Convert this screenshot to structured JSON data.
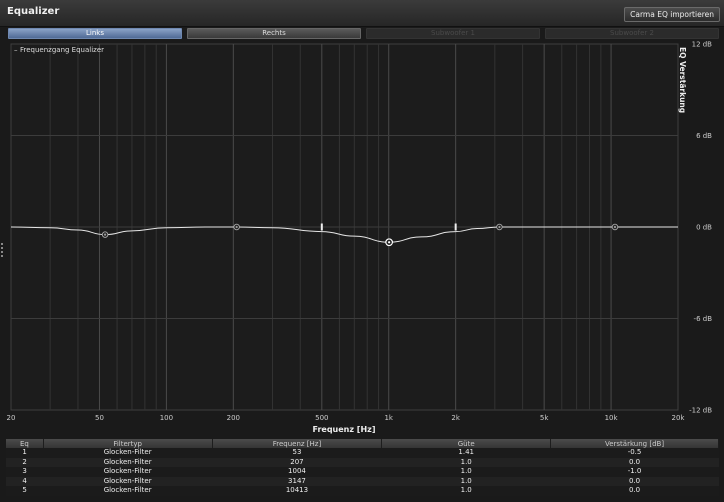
{
  "window": {
    "title": "Equalizer"
  },
  "toolbar": {
    "import_label": "Carma EQ importieren"
  },
  "tabs": [
    {
      "label": "Links",
      "state": "active"
    },
    {
      "label": "Rechts",
      "state": "normal"
    },
    {
      "label": "Subwoofer 1",
      "state": "disabled"
    },
    {
      "label": "Subwoofer 2",
      "state": "disabled"
    }
  ],
  "graph": {
    "legend": "Frequenzgang Equalizer"
  },
  "chart_data": {
    "type": "line",
    "title": "",
    "legend": [
      "Frequenzgang Equalizer"
    ],
    "xlabel": "Frequenz [Hz]",
    "ylabel": "EQ Verstärkung",
    "x_scale": "log",
    "xlim": [
      20,
      20000
    ],
    "ylim": [
      -12,
      12
    ],
    "x_ticks": [
      20,
      50,
      100,
      200,
      500,
      1000,
      2000,
      5000,
      10000,
      20000
    ],
    "x_tick_labels": [
      "20",
      "50",
      "100",
      "200",
      "500",
      "1k",
      "2k",
      "5k",
      "10k",
      "20k"
    ],
    "y_ticks": [
      12,
      6,
      0,
      -6,
      -12
    ],
    "y_tick_labels": [
      "12 dB",
      "6 dB",
      "0 dB",
      "-6 dB",
      "-12 dB"
    ],
    "grid": true,
    "series": [
      {
        "name": "Frequenzgang Equalizer",
        "x": [
          20,
          30,
          40,
          53,
          70,
          100,
          150,
          207,
          300,
          500,
          700,
          1004,
          1400,
          2000,
          2500,
          3147,
          5000,
          10413,
          20000
        ],
        "y": [
          0,
          -0.05,
          -0.2,
          -0.5,
          -0.25,
          -0.05,
          0,
          0,
          -0.05,
          -0.3,
          -0.6,
          -1.0,
          -0.65,
          -0.3,
          -0.1,
          0,
          0,
          0,
          0
        ]
      }
    ],
    "markers": [
      {
        "freq": 53,
        "gain": -0.5
      },
      {
        "freq": 207,
        "gain": 0.0
      },
      {
        "freq": 1004,
        "gain": -1.0
      },
      {
        "freq": 3147,
        "gain": 0.0
      },
      {
        "freq": 10413,
        "gain": 0.0
      }
    ],
    "bandwidth_markers": [
      {
        "freq": 500,
        "gain": 0.0
      },
      {
        "freq": 2000,
        "gain": 0.0
      }
    ]
  },
  "table": {
    "columns": [
      "Eq",
      "Filtertyp",
      "Frequenz [Hz]",
      "Güte",
      "Verstärkung [dB]"
    ],
    "rows": [
      [
        "1",
        "Glocken-Filter",
        "53",
        "1.41",
        "-0.5"
      ],
      [
        "2",
        "Glocken-Filter",
        "207",
        "1.0",
        "0.0"
      ],
      [
        "3",
        "Glocken-Filter",
        "1004",
        "1.0",
        "-1.0"
      ],
      [
        "4",
        "Glocken-Filter",
        "3147",
        "1.0",
        "0.0"
      ],
      [
        "5",
        "Glocken-Filter",
        "10413",
        "1.0",
        "0.0"
      ]
    ]
  }
}
